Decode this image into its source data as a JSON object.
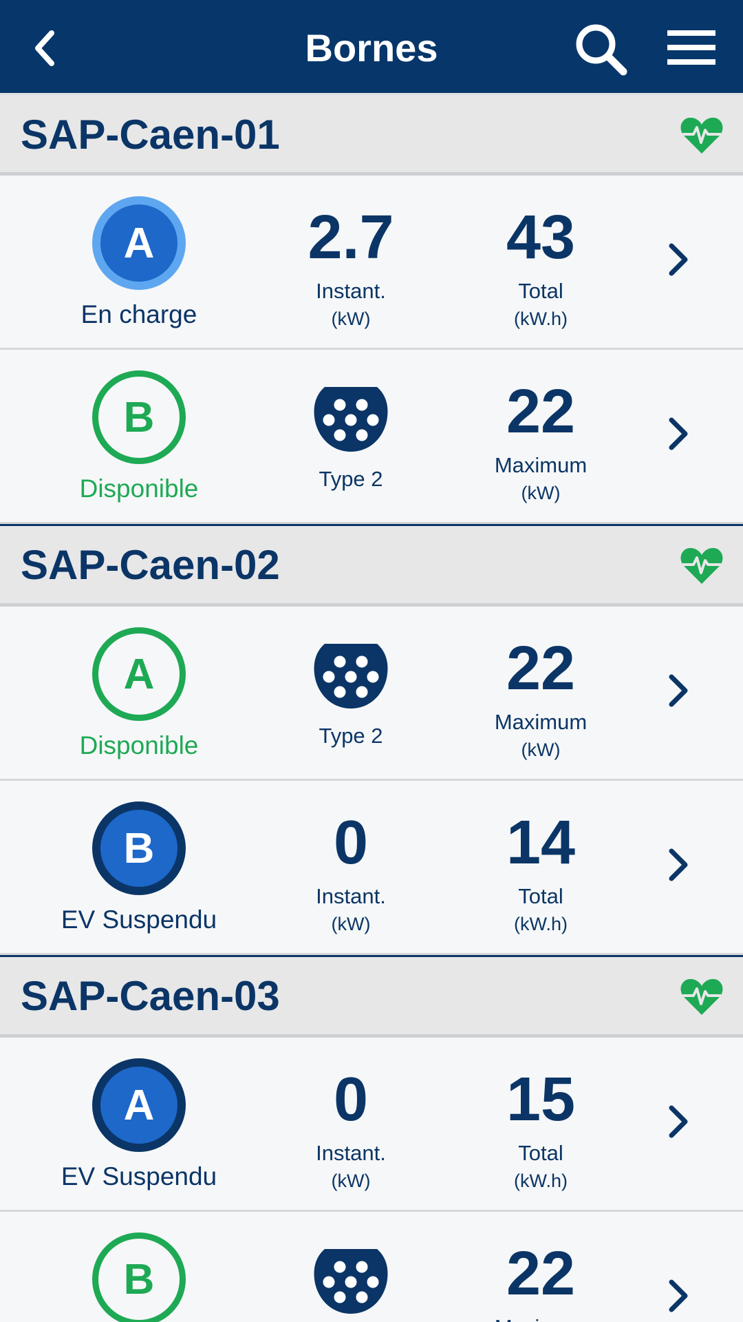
{
  "header": {
    "title": "Bornes",
    "back_icon": "chevron-left-icon",
    "search_icon": "search-icon",
    "menu_icon": "hamburger-menu-icon"
  },
  "colors": {
    "primary": "#07366a",
    "available": "#1ea955",
    "charging_fill": "#1d68c9",
    "charging_ring": "#5ea6f0"
  },
  "stations": [
    {
      "name": "SAP-Caen-01",
      "health_icon": "heartbeat-icon",
      "connectors": [
        {
          "letter": "A",
          "state": "charging",
          "status": "En charge",
          "m1": {
            "value": "2.7",
            "label": "Instant.",
            "unit": "(kW)"
          },
          "m2": {
            "value": "43",
            "label": "Total",
            "unit": "(kW.h)"
          }
        },
        {
          "letter": "B",
          "state": "available",
          "status": "Disponible",
          "plug": "Type 2",
          "m2": {
            "value": "22",
            "label": "Maximum",
            "unit": "(kW)"
          }
        }
      ]
    },
    {
      "name": "SAP-Caen-02",
      "health_icon": "heartbeat-icon",
      "connectors": [
        {
          "letter": "A",
          "state": "available",
          "status": "Disponible",
          "plug": "Type 2",
          "m2": {
            "value": "22",
            "label": "Maximum",
            "unit": "(kW)"
          }
        },
        {
          "letter": "B",
          "state": "suspended",
          "status": "EV Suspendu",
          "m1": {
            "value": "0",
            "label": "Instant.",
            "unit": "(kW)"
          },
          "m2": {
            "value": "14",
            "label": "Total",
            "unit": "(kW.h)"
          }
        }
      ]
    },
    {
      "name": "SAP-Caen-03",
      "health_icon": "heartbeat-icon",
      "connectors": [
        {
          "letter": "A",
          "state": "suspended",
          "status": "EV Suspendu",
          "m1": {
            "value": "0",
            "label": "Instant.",
            "unit": "(kW)"
          },
          "m2": {
            "value": "15",
            "label": "Total",
            "unit": "(kW.h)"
          }
        },
        {
          "letter": "B",
          "state": "available",
          "status": "",
          "plug": "",
          "m2": {
            "value": "22",
            "label": "Maximum",
            "unit": ""
          }
        }
      ]
    }
  ]
}
